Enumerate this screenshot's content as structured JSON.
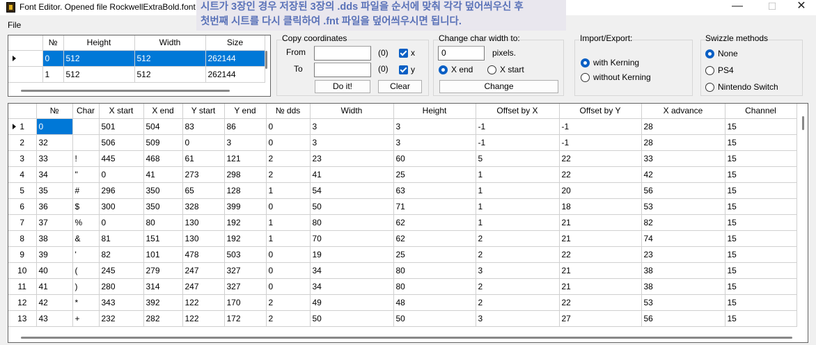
{
  "window": {
    "title": "Font Editor. Opened file RockwellExtraBold.font",
    "minimize_glyph": "—",
    "maximize_glyph": "☐",
    "close_glyph": "✕"
  },
  "note": {
    "line1": "시트가 3장인 경우 저장된 3장의 .dds 파일을 순서에 맞춰 각각 덮어씌우신 후",
    "line2": "첫번째 시트를 다시 클릭하여 .fnt 파일을 덮어씌우시면 됩니다."
  },
  "menu": {
    "file": "File"
  },
  "sheets": {
    "headers": [
      "№",
      "Height",
      "Width",
      "Size"
    ],
    "rows": [
      [
        "0",
        "512",
        "512",
        "262144"
      ],
      [
        "1",
        "512",
        "512",
        "262144"
      ]
    ]
  },
  "copy": {
    "title": "Copy coordinates",
    "from_label": "From",
    "to_label": "To",
    "from_value": "",
    "to_value": "",
    "from_hint": "(0)",
    "to_hint": "(0)",
    "x_label": "x",
    "y_label": "y",
    "do_it": "Do it!",
    "clear": "Clear"
  },
  "charwidth": {
    "title": "Change char width to:",
    "value": "0",
    "pixels": "pixels.",
    "xend": "X end",
    "xstart": "X start",
    "change": "Change"
  },
  "importexport": {
    "title": "Import/Export:",
    "with": "with Kerning",
    "without": "without Kerning"
  },
  "swizzle": {
    "title": "Swizzle methods",
    "none": "None",
    "ps4": "PS4",
    "switch": "Nintendo Switch"
  },
  "chars": {
    "headers": [
      "№",
      "Char",
      "X start",
      "X end",
      "Y start",
      "Y end",
      "№ dds",
      "Width",
      "Height",
      "Offset by X",
      "Offset by Y",
      "X advance",
      "Channel"
    ],
    "rows": [
      [
        "1",
        "0",
        "",
        "501",
        "504",
        "83",
        "86",
        "0",
        "3",
        "3",
        "-1",
        "-1",
        "28",
        "15"
      ],
      [
        "2",
        "32",
        "",
        "506",
        "509",
        "0",
        "3",
        "0",
        "3",
        "3",
        "-1",
        "-1",
        "28",
        "15"
      ],
      [
        "3",
        "33",
        "!",
        "445",
        "468",
        "61",
        "121",
        "2",
        "23",
        "60",
        "5",
        "22",
        "33",
        "15"
      ],
      [
        "4",
        "34",
        "\"",
        "0",
        "41",
        "273",
        "298",
        "2",
        "41",
        "25",
        "1",
        "22",
        "42",
        "15"
      ],
      [
        "5",
        "35",
        "#",
        "296",
        "350",
        "65",
        "128",
        "1",
        "54",
        "63",
        "1",
        "20",
        "56",
        "15"
      ],
      [
        "6",
        "36",
        "$",
        "300",
        "350",
        "328",
        "399",
        "0",
        "50",
        "71",
        "1",
        "18",
        "53",
        "15"
      ],
      [
        "7",
        "37",
        "%",
        "0",
        "80",
        "130",
        "192",
        "1",
        "80",
        "62",
        "1",
        "21",
        "82",
        "15"
      ],
      [
        "8",
        "38",
        "&",
        "81",
        "151",
        "130",
        "192",
        "1",
        "70",
        "62",
        "2",
        "21",
        "74",
        "15"
      ],
      [
        "9",
        "39",
        "'",
        "82",
        "101",
        "478",
        "503",
        "0",
        "19",
        "25",
        "2",
        "22",
        "23",
        "15"
      ],
      [
        "10",
        "40",
        "(",
        "245",
        "279",
        "247",
        "327",
        "0",
        "34",
        "80",
        "3",
        "21",
        "38",
        "15"
      ],
      [
        "11",
        "41",
        ")",
        "280",
        "314",
        "247",
        "327",
        "0",
        "34",
        "80",
        "2",
        "21",
        "38",
        "15"
      ],
      [
        "12",
        "42",
        "*",
        "343",
        "392",
        "122",
        "170",
        "2",
        "49",
        "48",
        "2",
        "22",
        "53",
        "15"
      ],
      [
        "13",
        "43",
        "+",
        "232",
        "282",
        "122",
        "172",
        "2",
        "50",
        "50",
        "3",
        "27",
        "56",
        "15"
      ]
    ]
  }
}
